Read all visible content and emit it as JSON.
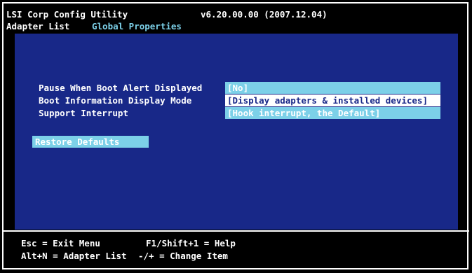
{
  "header": {
    "title": "LSI Corp Config Utility",
    "version": "v6.20.00.00 (2007.12.04)",
    "breadcrumb_root": "Adapter List",
    "breadcrumb_current": "Global Properties"
  },
  "properties": [
    {
      "label": "Pause When Boot Alert Displayed",
      "value": "[No]"
    },
    {
      "label": "Boot Information Display Mode",
      "value": "[Display adapters & installed devices]"
    },
    {
      "label": "Support Interrupt",
      "value": "[Hook interrupt, the Default]"
    }
  ],
  "restore_label": "Restore Defaults",
  "footer": {
    "row1_left": "Esc = Exit Menu",
    "row1_right": "F1/Shift+1 = Help",
    "row2_left": "Alt+N = Adapter List",
    "row2_right": "-/+ = Change Item"
  },
  "colors": {
    "background": "#182888",
    "highlight": "#7cd0e8",
    "text": "#ffffff",
    "frame": "#000000"
  }
}
